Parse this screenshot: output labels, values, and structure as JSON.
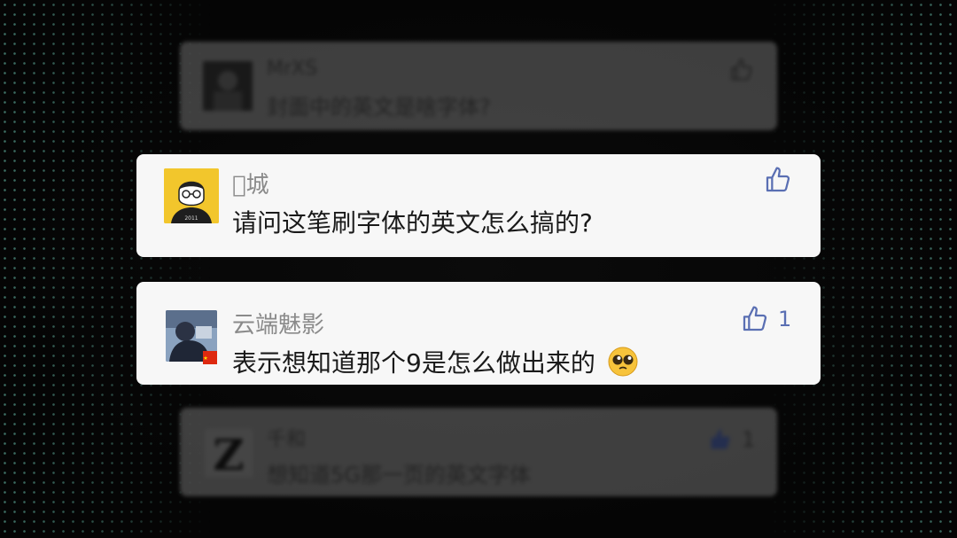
{
  "comments": [
    {
      "username": "MrXS",
      "text": "封面中的英文是啥字体?",
      "likes": "",
      "state": "blurred"
    },
    {
      "username": "\u0000城",
      "text": "请问这笔刷字体的英文怎么搞的?",
      "likes": "",
      "state": "focused"
    },
    {
      "username": "云端魅影",
      "text": "表示想知道那个9是怎么做出来的",
      "likes": "1",
      "state": "focused",
      "emoji": "pleading-face-emoji"
    },
    {
      "username": "千和",
      "text": "想知道5G那一页的英文字体",
      "likes": "1",
      "state": "blurred"
    }
  ],
  "colors": {
    "background": "#050505",
    "card": "#f7f7f7",
    "username": "#8a8a8a",
    "text": "#1a1a1a",
    "like_icon": "#5a6fb3",
    "dots": "#6ec8b4"
  },
  "icons": [
    "thumbs-up-icon",
    "china-flag-icon",
    "pleading-face-emoji"
  ]
}
